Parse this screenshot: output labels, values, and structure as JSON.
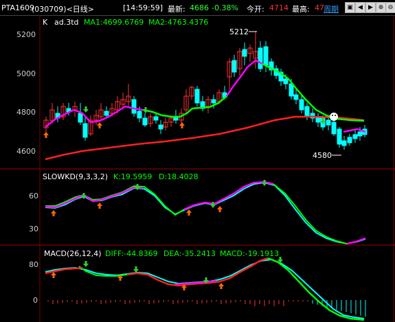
{
  "header": {
    "symbol": "PTA1609",
    "code_period": "(030709)<日线>",
    "time": "[14:59:59]",
    "latest_label": "最新:",
    "latest_value": "4686",
    "change_pct": "-0.38%",
    "open_label": "今开:",
    "open_value": "4714",
    "high_label": "最高:",
    "high_value": "47",
    "period_link": "周期",
    "controls": [
      "window-restore-icon",
      "arrow-left-icon",
      "arrow-right-icon",
      "zoom-in-icon",
      "zoom-out-icon"
    ]
  },
  "kline_panel": {
    "title_k": "K",
    "title_name": "ad.3td",
    "ma1": "MA1:4699.6769",
    "ma2": "MA2:4763.4376",
    "yticks": [
      "5200",
      "5000",
      "4800",
      "4600"
    ],
    "high_marker": "5212",
    "low_marker": "4580"
  },
  "kd_panel": {
    "title": "SLOWKD(9,3,3,2)",
    "k": "K:19.5959",
    "d": "D:18.4028",
    "yticks": [
      "60",
      "30"
    ]
  },
  "macd_panel": {
    "title": "MACD(26,12,4)",
    "diff": "DIFF:-44.8369",
    "dea": "DEA:-35.2413",
    "macd": "MACD:-19.1913",
    "yticks": [
      "80",
      "0"
    ]
  },
  "colors": {
    "up": "#ff3333",
    "down": "#00ffff",
    "ma1": "#ff00ff",
    "ma1_alt": "#00ff00",
    "ma2": "#ff2020",
    "grid": "#800000",
    "arrow_up": "#ff6600",
    "arrow_down": "#33cc33"
  }
}
